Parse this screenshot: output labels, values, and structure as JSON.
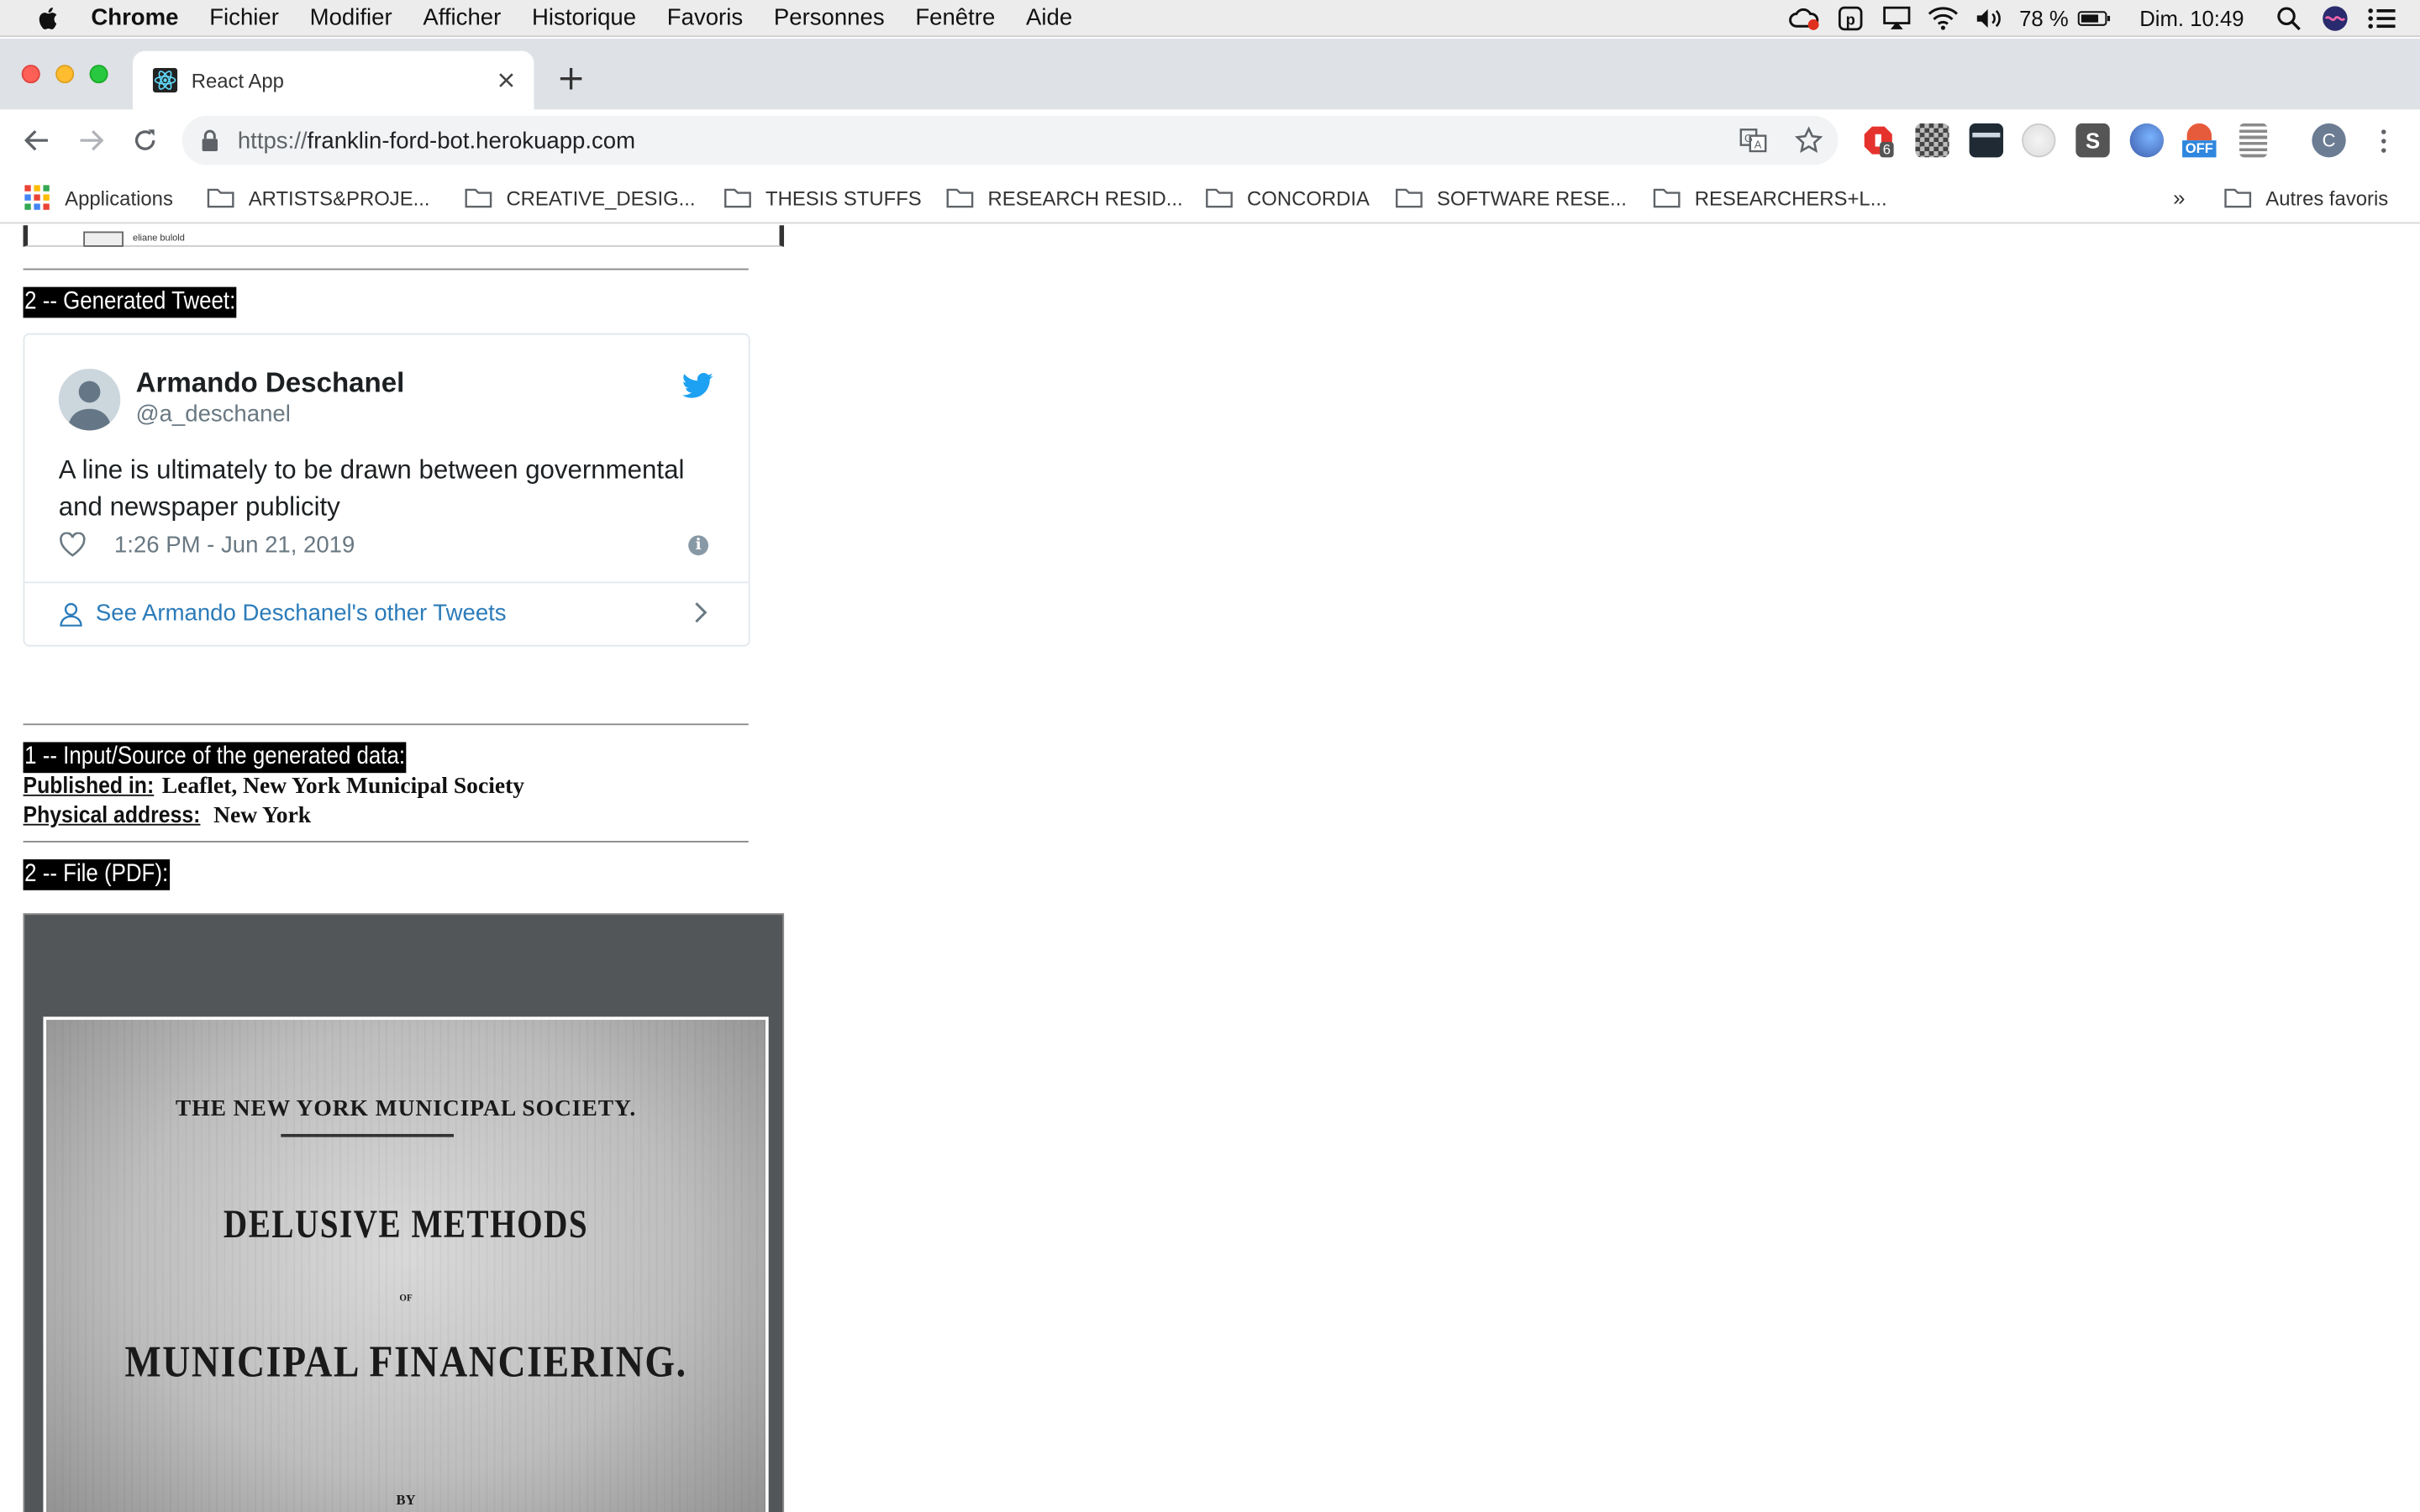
{
  "menubar": {
    "app_name": "Chrome",
    "items": [
      "Fichier",
      "Modifier",
      "Afficher",
      "Historique",
      "Favoris",
      "Personnes",
      "Fenêtre",
      "Aide"
    ],
    "battery": "78 %",
    "clock": "Dim. 10:49",
    "icons": [
      "creative-cloud-icon",
      "pocket-icon",
      "airplay-icon",
      "wifi-icon",
      "volume-icon",
      "battery-icon",
      "spotlight-icon",
      "siri-icon",
      "notification-center-icon"
    ]
  },
  "browser": {
    "tab_title": "React App",
    "url_scheme": "https://",
    "url_host": "franklin-ford-bot.herokuapp.com",
    "extension_badge": "6",
    "extension_off_label": "OFF",
    "profile_initial": "C"
  },
  "bookmarks": {
    "apps_label": "Applications",
    "items": [
      "ARTISTS&PROJE...",
      "CREATIVE_DESIG...",
      "THESIS STUFFS",
      "RESEARCH RESID...",
      "CONCORDIA",
      "SOFTWARE RESE...",
      "RESEARCHERS+L..."
    ],
    "overflow": "»",
    "other": "Autres favoris"
  },
  "page": {
    "fragment_caption": "eliane bulold",
    "generated_tweet_heading": "2 -- Generated Tweet:",
    "tweet": {
      "name": "Armando Deschanel",
      "handle": "@a_deschanel",
      "text": "A line is ultimately to be drawn between governmental and newspaper publicity",
      "timestamp": "1:26 PM - Jun 21, 2019",
      "more_link": "See Armando Deschanel's other Tweets"
    },
    "source_heading": "1 -- Input/Source of the generated data:",
    "published_label": "Published in:",
    "published_value": "Leaflet, New York Municipal Society",
    "address_label": "Physical address:",
    "address_value": "New York",
    "file_heading": "2 -- File (PDF):",
    "pdf": {
      "line1": "THE NEW YORK MUNICIPAL SOCIETY.",
      "line2": "DELUSIVE METHODS",
      "line3": "OF",
      "line4": "MUNICIPAL FINANCIERING.",
      "line5": "BY"
    }
  }
}
